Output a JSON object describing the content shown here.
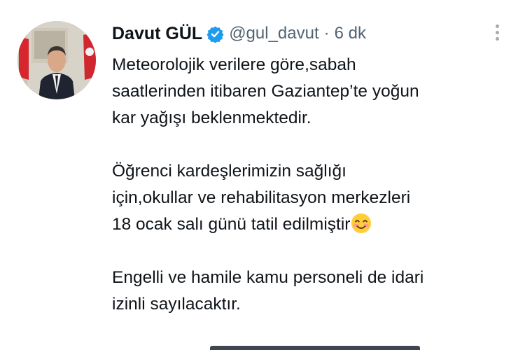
{
  "tweet": {
    "author": {
      "display_name": "Davut GÜL",
      "handle": "@gul_davut",
      "verified": true
    },
    "separator": "·",
    "timestamp": "6 dk",
    "paragraphs": [
      {
        "lines": [
          "Meteorolojik verilere göre,sabah",
          "saatlerinden itibaren Gaziantep’te yoğun",
          "kar yağışı beklenmektedir."
        ]
      },
      {
        "lines": [
          "Öğrenci kardeşlerimizin sağlığı",
          "için,okullar ve rehabilitasyon merkezleri",
          "18 ocak salı günü tatil edilmiştir"
        ],
        "trailing_emoji": "smiling-face-with-smiling-eyes"
      },
      {
        "lines": [
          "Engelli ve hamile kamu personeli de idari",
          "izinli sayılacaktır."
        ]
      }
    ]
  },
  "icons": {
    "verified": "verified-badge-icon",
    "more": "more-options-icon",
    "emoji": "smiling-face-emoji-icon"
  },
  "colors": {
    "verified_blue": "#1d9bf0",
    "text_primary": "#0f1419",
    "text_secondary": "#536471"
  }
}
